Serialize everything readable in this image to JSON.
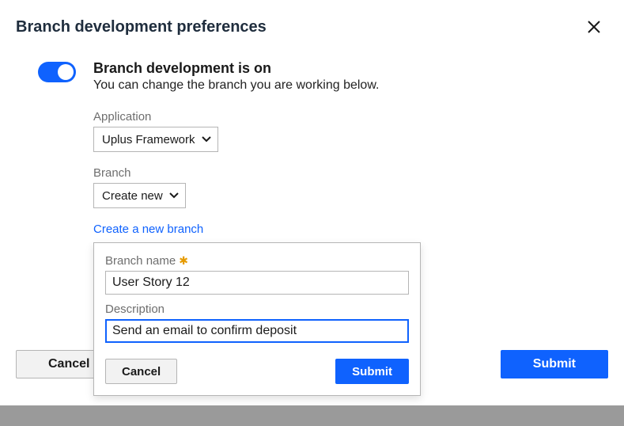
{
  "dialog": {
    "title": "Branch development preferences",
    "toggle": {
      "title": "Branch development is on",
      "description": "You can change the branch you are working below."
    },
    "application": {
      "label": "Application",
      "value": "Uplus Framework"
    },
    "branch": {
      "label": "Branch",
      "value": "Create new"
    },
    "create_link": "Create a new branch",
    "sub": {
      "name_label": "Branch name",
      "name_value": "User Story 12",
      "desc_label": "Description",
      "desc_value": "Send an email to confirm deposit",
      "cancel_label": "Cancel",
      "submit_label": "Submit"
    },
    "actions": {
      "cancel_label": "Cancel",
      "submit_label": "Submit"
    }
  }
}
